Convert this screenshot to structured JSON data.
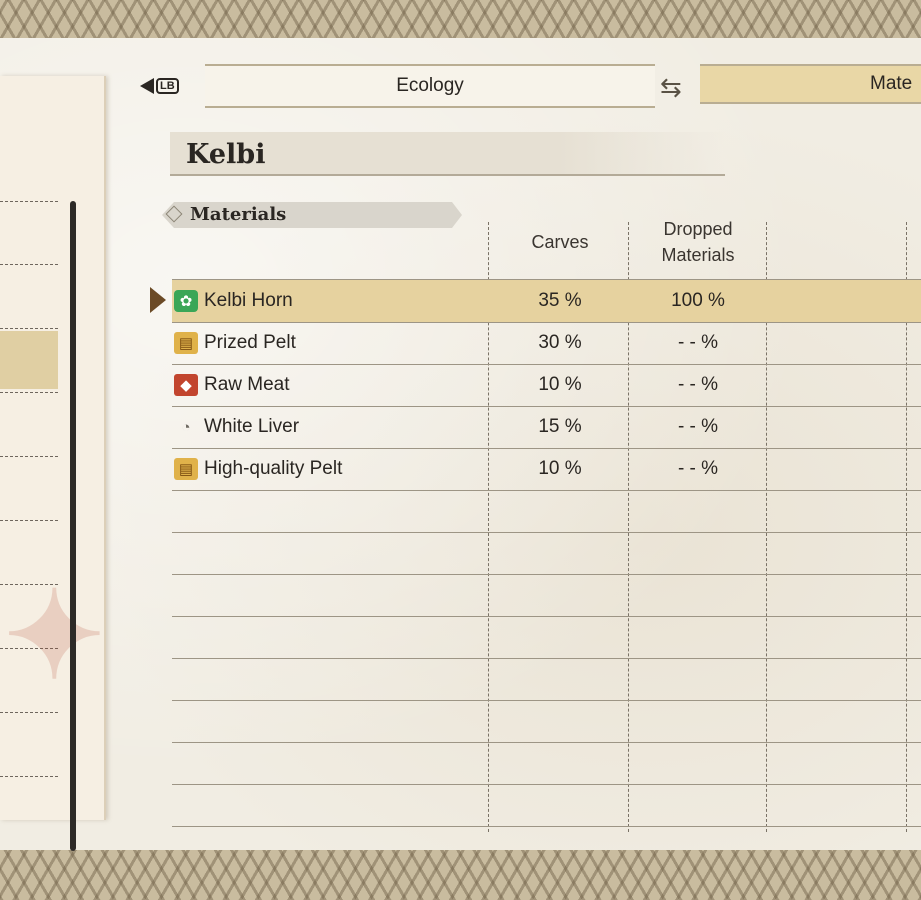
{
  "tabs": {
    "left_button": "LB",
    "ecology_label": "Ecology",
    "active_label": "Mate"
  },
  "monster": {
    "name": "Kelbi"
  },
  "materials": {
    "section_label": "Materials",
    "columns": {
      "carves": "Carves",
      "dropped": "Dropped Materials"
    },
    "rows": [
      {
        "icon": "horn-icon",
        "name": "Kelbi Horn",
        "carves": "35 %",
        "dropped": "100 %",
        "selected": true
      },
      {
        "icon": "pelt-icon",
        "name": "Prized Pelt",
        "carves": "30 %",
        "dropped": "- - %"
      },
      {
        "icon": "meat-icon",
        "name": "Raw Meat",
        "carves": "10 %",
        "dropped": "- - %"
      },
      {
        "icon": "liver-icon",
        "name": "White Liver",
        "carves": "15 %",
        "dropped": "- - %"
      },
      {
        "icon": "pelt-icon",
        "name": "High-quality Pelt",
        "carves": "10 %",
        "dropped": "- - %"
      }
    ]
  },
  "colors": {
    "highlight": "#e6d29f",
    "parchment": "#f1ede3"
  }
}
